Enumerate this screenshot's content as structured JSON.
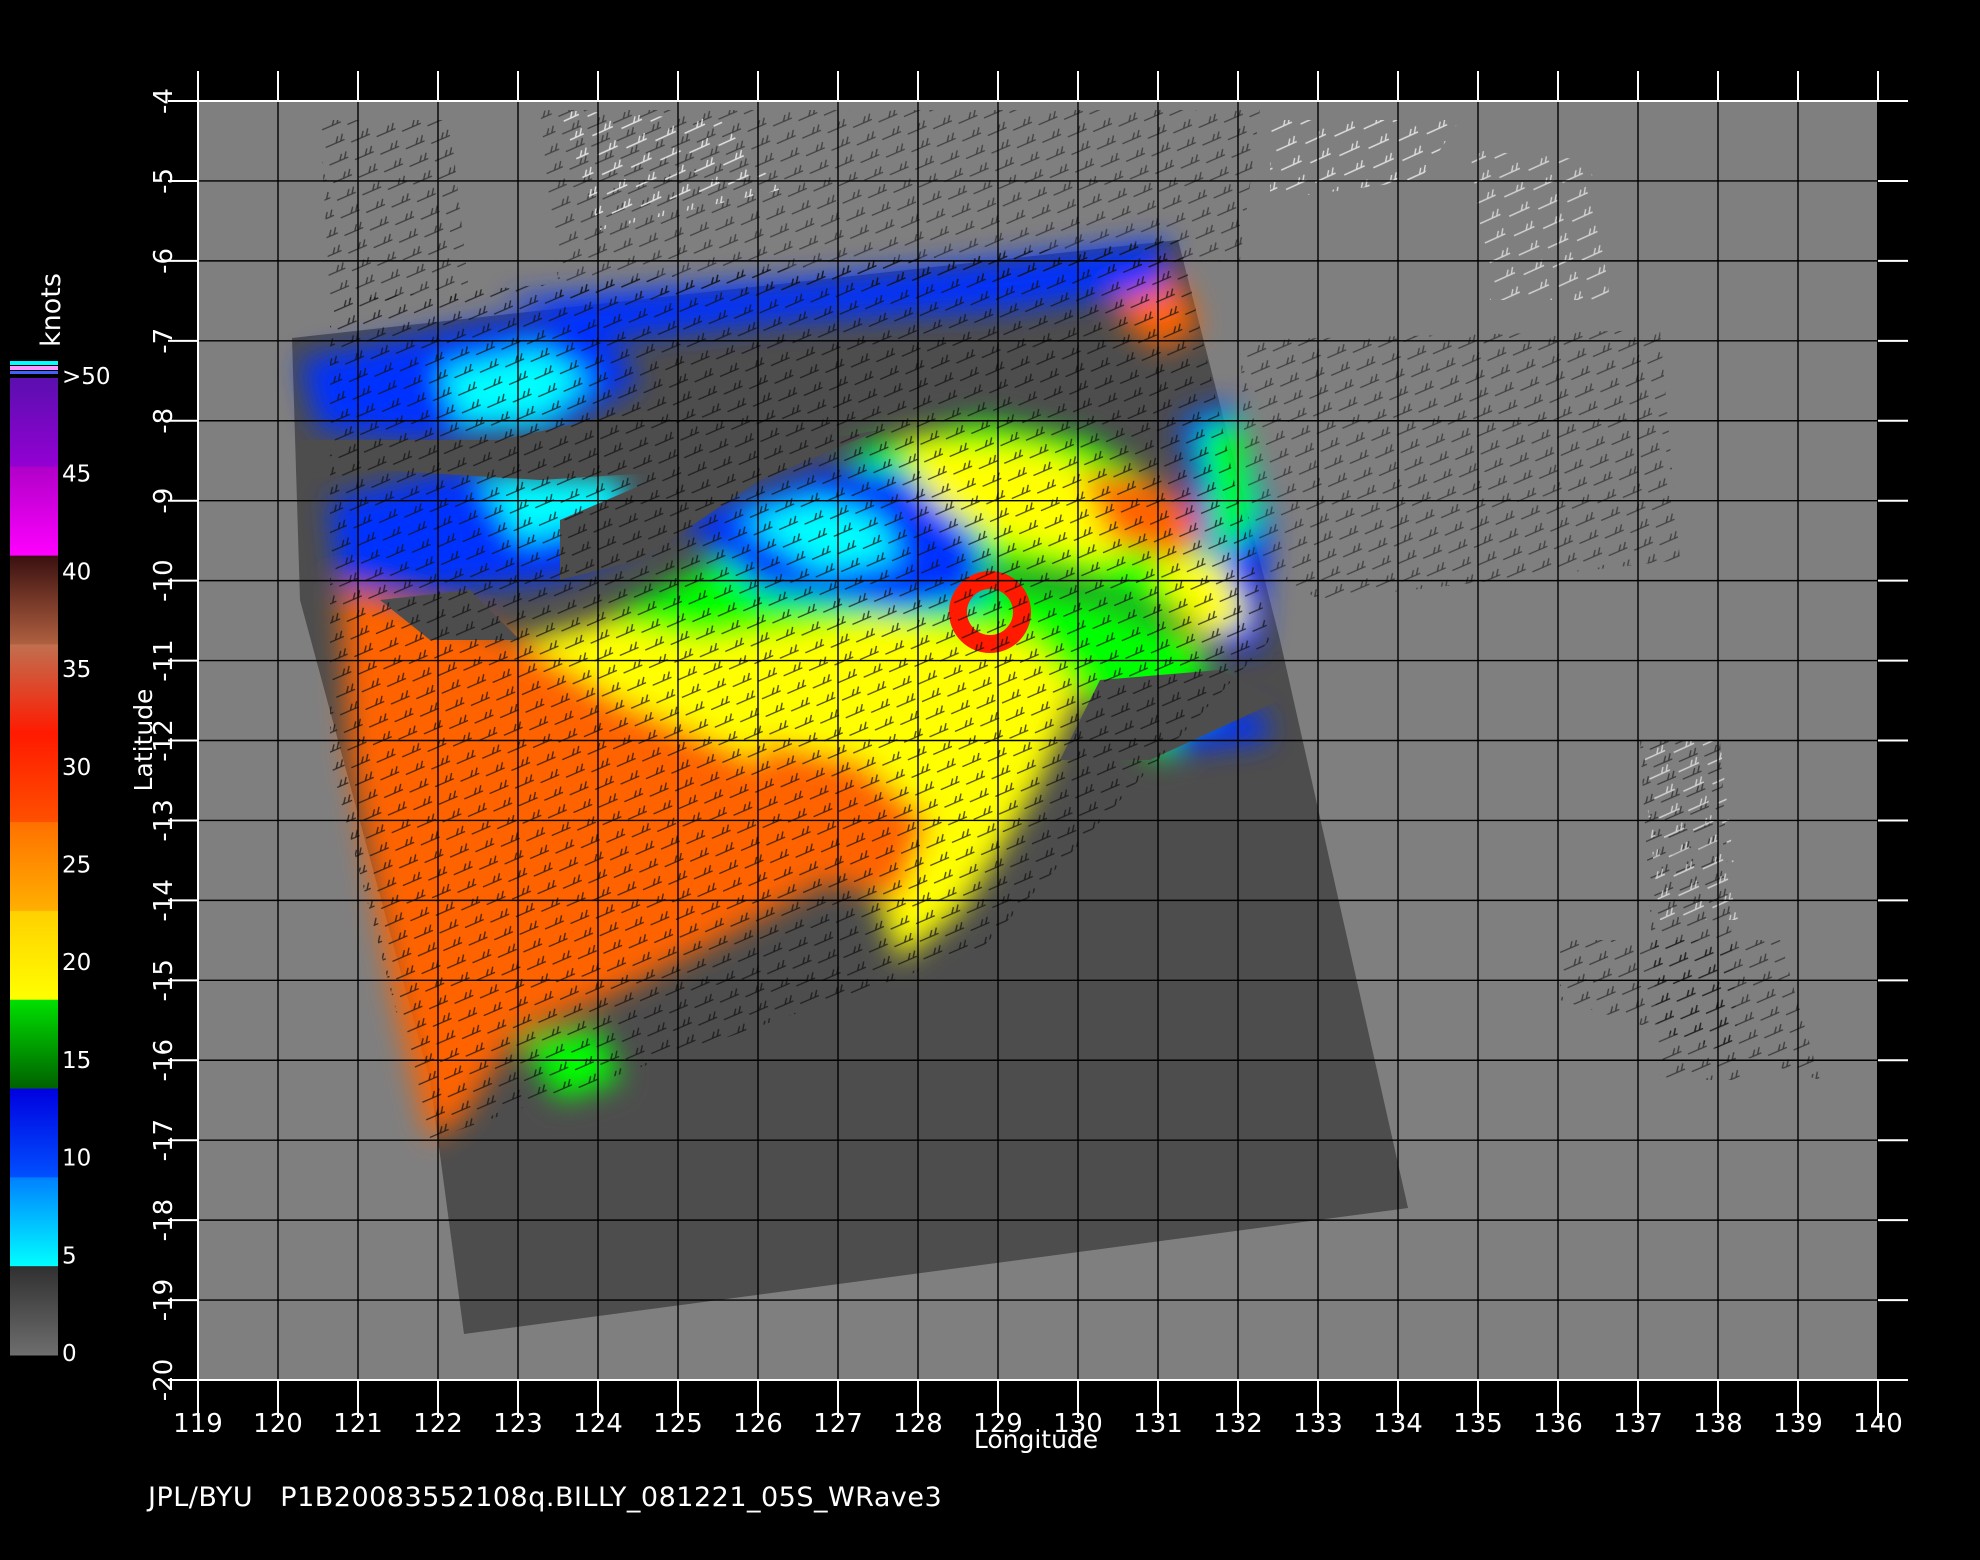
{
  "colorbar": {
    "unit": "knots",
    "labels": [
      ">50",
      "45",
      "40",
      "35",
      "30",
      "25",
      "20",
      "15",
      "10",
      "5",
      "0"
    ],
    "colors": {
      "c0": "#4a4a4a",
      "c5": "#00ffff",
      "c10": "#0032ff",
      "c15": "#007800",
      "c20": "#00ff00",
      "c25": "#ffff00",
      "c30": "#ff6400",
      "c35": "#ff1a00",
      "c40": "#4d1a1a",
      "c45": "#ff00ff",
      "c50": "#6b0fc4"
    }
  },
  "map": {
    "xlabel": "Longitude",
    "ylabel": "Latitude",
    "lon_ticks": [
      "119",
      "120",
      "121",
      "122",
      "123",
      "124",
      "125",
      "126",
      "127",
      "128",
      "129",
      "130",
      "131",
      "132",
      "133",
      "134",
      "135",
      "136",
      "137",
      "138",
      "139",
      "140"
    ],
    "lat_ticks": [
      "-4",
      "-5",
      "-6",
      "-7",
      "-8",
      "-9",
      "-10",
      "-11",
      "-12",
      "-13",
      "-14",
      "-15",
      "-16",
      "-17",
      "-18",
      "-19",
      "-20"
    ],
    "background_color": "#7f7f7f",
    "swath_color": "#4d4d4d",
    "grid_color": "#000000"
  },
  "footer": {
    "source": "JPL/BYU",
    "file_id": "P1B20083552108q.BILLY_081221_05S_WRave3"
  }
}
